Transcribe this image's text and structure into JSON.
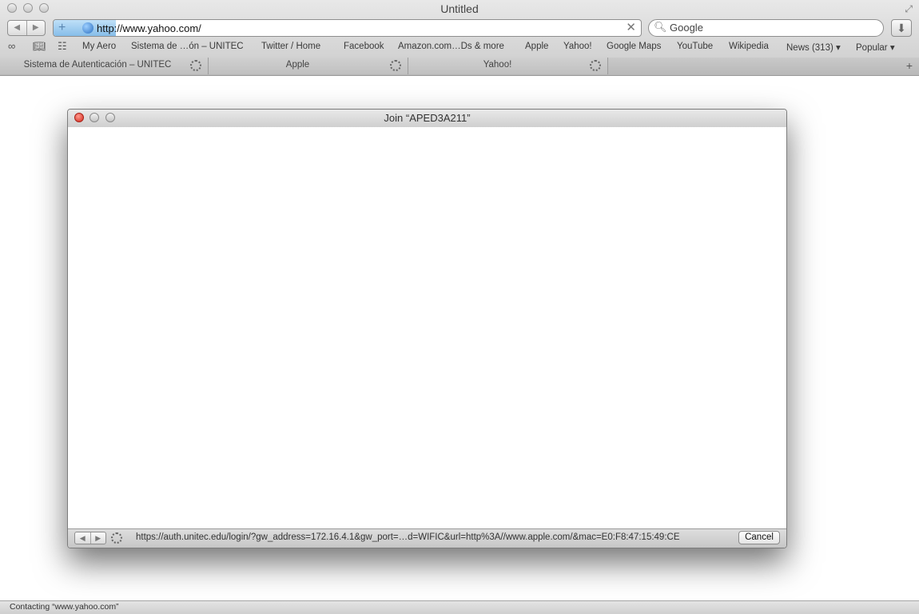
{
  "window": {
    "title": "Untitled"
  },
  "toolbar": {
    "url": "http://www.yahoo.com/",
    "search_placeholder": "Google"
  },
  "bookmarks": [
    "My Aero",
    "Sistema de …ón – UNITEC",
    "Twitter / Home",
    "Facebook",
    "Amazon.com…Ds & more",
    "Apple",
    "Yahoo!",
    "Google Maps",
    "YouTube",
    "Wikipedia",
    "News (313) ▾",
    "Popular ▾"
  ],
  "tabs": [
    {
      "label": "Sistema de Autenticación – UNITEC"
    },
    {
      "label": "Apple"
    },
    {
      "label": "Yahoo!"
    }
  ],
  "dialog": {
    "title": "Join “APED3A211”",
    "status_url": "https://auth.unitec.edu/login/?gw_address=172.16.4.1&gw_port=…d=WIFIC&url=http%3A//www.apple.com/&mac=E0:F8:47:15:49:CE",
    "cancel_label": "Cancel"
  },
  "status": {
    "text": "Contacting “www.yahoo.com”"
  }
}
